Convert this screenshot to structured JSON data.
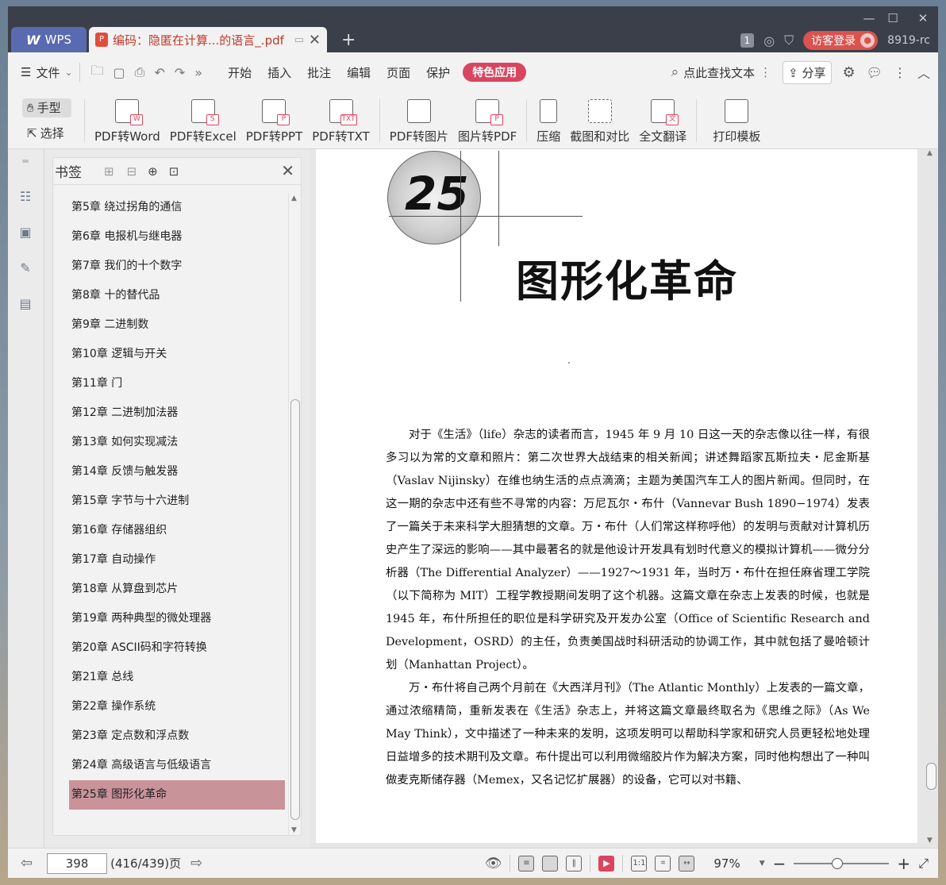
{
  "window": {
    "minimize": "—",
    "maximize": "☐",
    "close": "✕"
  },
  "tabs": {
    "wps_label": "WPS",
    "doc_title": "编码：隐匿在计算...的语言_.pdf",
    "new_tab": "+"
  },
  "titlebar_right": {
    "badge": "1",
    "login_label": "访客登录",
    "version": "8919-rc"
  },
  "menu": {
    "file_label": "文件",
    "items": [
      "开始",
      "插入",
      "批注",
      "编辑",
      "页面",
      "保护"
    ],
    "special_label": "特色应用",
    "search_placeholder": "点此查找文本",
    "share_label": "分享"
  },
  "ribbon": {
    "mode_hand": "手型",
    "mode_select": "选择",
    "buttons": [
      {
        "label": "PDF转Word",
        "tag": "W"
      },
      {
        "label": "PDF转Excel",
        "tag": "S"
      },
      {
        "label": "PDF转PPT",
        "tag": "P"
      },
      {
        "label": "PDF转TXT",
        "tag": "TXT"
      },
      {
        "label": "PDF转图片",
        "tag": ""
      },
      {
        "label": "图片转PDF",
        "tag": "P"
      },
      {
        "label": "压缩",
        "tag": ""
      },
      {
        "label": "截图和对比",
        "tag": ""
      },
      {
        "label": "全文翻译",
        "tag": "文"
      },
      {
        "label": "打印模板",
        "tag": ""
      }
    ]
  },
  "bookmarks": {
    "title": "书签",
    "items": [
      "第5章 绕过拐角的通信",
      "第6章 电报机与继电器",
      "第7章 我们的十个数字",
      "第8章 十的替代品",
      "第9章 二进制数",
      "第10章 逻辑与开关",
      "第11章 门",
      "第12章 二进制加法器",
      "第13章 如何实现减法",
      "第14章 反馈与触发器",
      "第15章 字节与十六进制",
      "第16章 存储器组织",
      "第17章 自动操作",
      "第18章 从算盘到芯片",
      "第19章 两种典型的微处理器",
      "第20章 ASCII码和字符转换",
      "第21章 总线",
      "第22章 操作系统",
      "第23章 定点数和浮点数",
      "第24章 高级语言与低级语言",
      "第25章 图形化革命"
    ],
    "selected_index": 20
  },
  "document": {
    "chapter_number": "25",
    "chapter_title": "图形化革命",
    "p1": "对于《生活》（life）杂志的读者而言，1945 年 9 月 10 日这一天的杂志像以往一样，有很多习以为常的文章和照片：第二次世界大战结束的相关新闻；讲述舞蹈家瓦斯拉夫・尼金斯基（Vaslav Nijinsky）在维也纳生活的点点滴滴；主题为美国汽车工人的图片新闻。但同时，在这一期的杂志中还有些不寻常的内容：万尼瓦尔・布什（Vannevar Bush 1890−1974）发表了一篇关于未来科学大胆猜想的文章。万・布什（人们常这样称呼他）的发明与贡献对计算机历史产生了深远的影响——其中最著名的就是他设计开发具有划时代意义的模拟计算机——微分分析器（The Differential Analyzer）——1927～1931 年，当时万・布什在担任麻省理工学院（以下简称为 MIT）工程学教授期间发明了这个机器。这篇文章在杂志上发表的时候，也就是 1945 年，布什所担任的职位是科学研究及开发办公室（Office of Scientific Research and Development，OSRD）的主任，负责美国战时科研活动的协调工作，其中就包括了曼哈顿计划（Manhattan Project）。",
    "p2": "万・布什将自己两个月前在《大西洋月刊》（The Atlantic Monthly）上发表的一篇文章，通过浓缩精简，重新发表在《生活》杂志上，并将这篇文章最终取名为《思维之际》（As We May Think），文中描述了一种未来的发明，这项发明可以帮助科学家和研究人员更轻松地处理日益增多的技术期刊及文章。布什提出可以利用微缩胶片作为解决方案，同时他构想出了一种叫做麦克斯储存器（Memex，又名记忆扩展器）的设备，它可以对书籍、"
  },
  "status": {
    "page_input": "398",
    "page_info": "(416/439)页",
    "zoom": "97%",
    "zoom_level": 0.45
  },
  "colors": {
    "accent": "#d9455f",
    "selected_bookmark": "#c9939a",
    "titlebar": "#3b3f4a"
  }
}
